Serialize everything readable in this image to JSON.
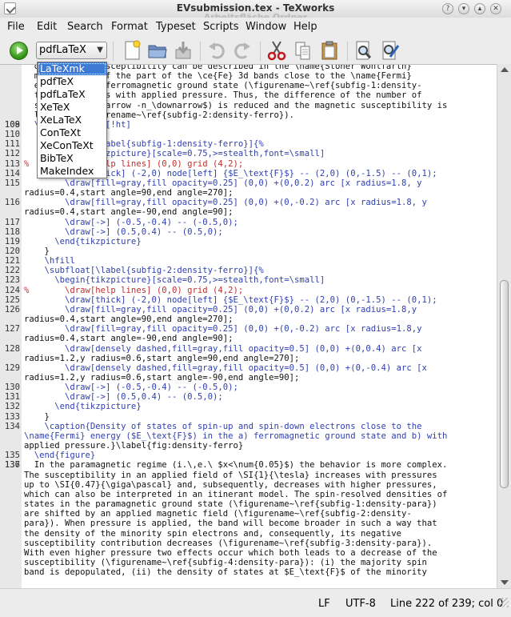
{
  "window": {
    "title": "EVsubmission.tex - TeXworks",
    "subtitle": "Arbeitsfläche Ordner",
    "controls": [
      "?",
      "▾",
      "▴",
      "✕"
    ]
  },
  "menu": [
    "File",
    "Edit",
    "Search",
    "Format",
    "Typeset",
    "Scripts",
    "Window",
    "Help"
  ],
  "toolbar": {
    "run_icon": "play-icon",
    "engine_selected": "pdfLaTeX",
    "icons": [
      "new-document-icon",
      "open-folder-icon",
      "save-icon",
      "undo-icon",
      "redo-icon",
      "cut-icon",
      "copy-icon",
      "paste-icon",
      "find-icon",
      "replace-icon"
    ]
  },
  "engine_options": [
    "LaTeXmk",
    "pdfTeX",
    "pdfLaTeX",
    "XeTeX",
    "XeLaTeX",
    "ConTeXt",
    "XeConTeXt",
    "BibTeX",
    "MakeIndex"
  ],
  "editor": {
    "lines": [
      {
        "n": "",
        "t": "  of the spin susceptibility can be described in the \\name{Stoner Wohlfarth}"
      },
      {
        "n": "",
        "t": "  model, which of the part of the \\ce{Fe} 3d bands close to the \\name{Fermi}"
      },
      {
        "n": "",
        "t": "  energy in the ferromagnetic ground state (\\figurename~\\ref{subfig-1:density-"
      },
      {
        "n": "",
        "t": "  ferro}) changes with applied pressure. Thus, the difference of the number of"
      },
      {
        "n": "",
        "t": "  states at $\\uparrow -n_\\downarrow$) is reduced and the magnetic susceptibility is"
      },
      {
        "n": "",
        "t": "  lowered (\\figurename~\\ref{subfig-2:density-ferro})."
      },
      {
        "n": "108",
        "t": ""
      },
      {
        "n": "109",
        "t": "  \\begin{figure}[!ht]"
      },
      {
        "n": "110",
        "t": "    \\centering"
      },
      {
        "n": "111",
        "t": "    \\subfloat[\\label{subfig-1:density-ferro}]{%"
      },
      {
        "n": "112",
        "t": "      \\begin{tikzpicture}[scale=0.75,>=stealth,font=\\small]"
      },
      {
        "n": "113",
        "t": "%       \\draw[help lines] (0,0) grid (4,2);"
      },
      {
        "n": "114",
        "t": "        \\draw[thick] (-2,0) node[left] {$E_\\text{F}$} -- (2,0) (0,-1.5) -- (0,1);"
      },
      {
        "n": "115",
        "t": "        \\draw[fill=gray,fill opacity=0.25] (0,0) +(0,0.2) arc [x radius=1.8, y"
      },
      {
        "n": "",
        "t": "radius=0.4,start angle=90,end angle=270];"
      },
      {
        "n": "116",
        "t": "        \\draw[fill=gray,fill opacity=0.25] (0,0) +(0,-0.2) arc [x radius=1.8, y"
      },
      {
        "n": "",
        "t": "radius=0.4,start angle=-90,end angle=90];"
      },
      {
        "n": "117",
        "t": "        \\draw[->] (-0.5,-0.4) -- (-0.5,0);"
      },
      {
        "n": "118",
        "t": "        \\draw[->] (0.5,0.4) -- (0.5,0);"
      },
      {
        "n": "119",
        "t": "      \\end{tikzpicture}"
      },
      {
        "n": "120",
        "t": "    }"
      },
      {
        "n": "121",
        "t": "    \\hfill"
      },
      {
        "n": "122",
        "t": "    \\subfloat[\\label{subfig-2:density-ferro}]{%"
      },
      {
        "n": "123",
        "t": "      \\begin{tikzpicture}[scale=0.75,>=stealth,font=\\small]"
      },
      {
        "n": "124",
        "t": "%       \\draw[help lines] (0,0) grid (4,2);"
      },
      {
        "n": "125",
        "t": "        \\draw[thick] (-2,0) node[left] {$E_\\text{F}$} -- (2,0) (0,-1.5) -- (0,1);"
      },
      {
        "n": "126",
        "t": "        \\draw[fill=gray,fill opacity=0.25] (0,0) +(0,0.2) arc [x radius=1.8,y"
      },
      {
        "n": "",
        "t": "radius=0.4,start angle=90,end angle=270];"
      },
      {
        "n": "127",
        "t": "        \\draw[fill=gray,fill opacity=0.25] (0,0) +(0,-0.2) arc [x radius=1.8,y"
      },
      {
        "n": "",
        "t": "radius=0.4,start angle=-90,end angle=90];"
      },
      {
        "n": "128",
        "t": "        \\draw[densely dashed,fill=gray,fill opacity=0.5] (0,0) +(0,0.4) arc [x"
      },
      {
        "n": "",
        "t": "radius=1.2,y radius=0.6,start angle=90,end angle=270];"
      },
      {
        "n": "129",
        "t": "        \\draw[densely dashed,fill=gray,fill opacity=0.5] (0,0) +(0,-0.4) arc [x"
      },
      {
        "n": "",
        "t": "radius=1.2,y radius=0.6,start angle=-90,end angle=90];"
      },
      {
        "n": "130",
        "t": "        \\draw[->] (-0.5,-0.4) -- (-0.5,0);"
      },
      {
        "n": "131",
        "t": "        \\draw[->] (0.5,0.4) -- (0.5,0);"
      },
      {
        "n": "132",
        "t": "      \\end{tikzpicture}"
      },
      {
        "n": "133",
        "t": "    }"
      },
      {
        "n": "134",
        "t": "    \\caption{Density of states of spin-up and spin-down electrons close to the"
      },
      {
        "n": "",
        "t": "\\name{Fermi} energy ($E_\\text{F}$) in the a) ferromagnetic ground state and b) with"
      },
      {
        "n": "",
        "t": "applied pressure.}\\label{fig:density-ferro}"
      },
      {
        "n": "135",
        "t": "  \\end{figure}"
      },
      {
        "n": "136",
        "t": ""
      },
      {
        "n": "137",
        "t": "  In the paramagnetic regime (i.\\,e.\\ $x<\\num{0.05}$) the behavior is more complex."
      },
      {
        "n": "",
        "t": "The susceptibility in an applied field of \\SI{1}{\\tesla} increases with pressures"
      },
      {
        "n": "",
        "t": "up to \\SI{0.47}{\\giga\\pascal} and, subsequently, decreases with higher pressures,"
      },
      {
        "n": "",
        "t": "which can also be interpreted in an itinerant model. The spin-resolved densities of"
      },
      {
        "n": "",
        "t": "states in the paramagnetic ground state (\\figurename~\\ref{subfig-1:density-para})"
      },
      {
        "n": "",
        "t": "are shifted by an applied magnetic field (\\figurename~\\ref{subfig-2:density-"
      },
      {
        "n": "",
        "t": "para}). When pressure is applied, the band will become broader in such a way that"
      },
      {
        "n": "",
        "t": "the density of the minority spin electrons and, consequently, its negative"
      },
      {
        "n": "",
        "t": "susceptibility contribution decreases (\\figurename~\\ref{subfig-3:density-para})."
      },
      {
        "n": "",
        "t": "With even higher pressure two effects occur which both leads to a decrease of the"
      },
      {
        "n": "",
        "t": "susceptibility (\\figurename~\\ref{subfig-4:density-para}): (i) the majority spin"
      },
      {
        "n": "",
        "t": "band is depopulated, (ii) the density of states at $E_\\text{F}$ of the minority"
      }
    ]
  },
  "status": {
    "line_ending": "LF",
    "encoding": "UTF-8",
    "position": "Line 222 of 239; col 0"
  }
}
